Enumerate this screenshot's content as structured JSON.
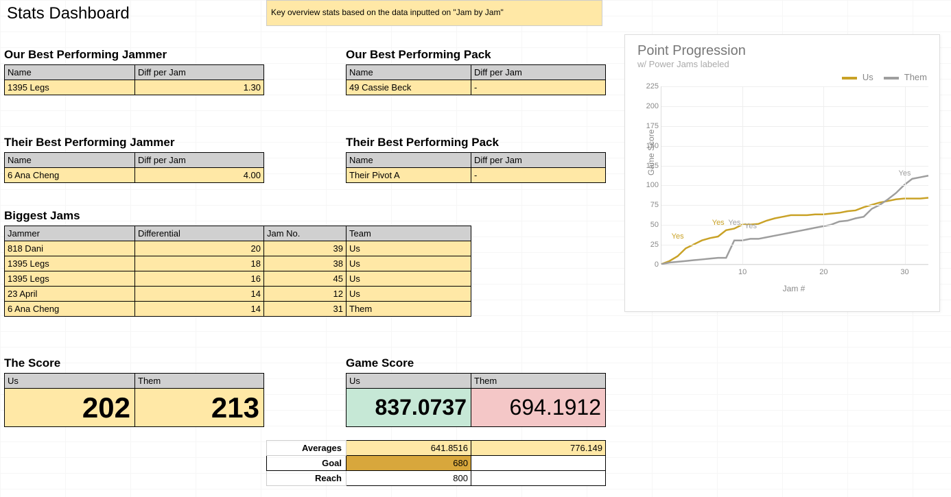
{
  "header": {
    "title": "Stats Dashboard",
    "banner": "Key overview stats based on the data inputted on \"Jam by Jam\""
  },
  "our_jammer": {
    "heading": "Our Best Performing Jammer",
    "col_name": "Name",
    "col_diff": "Diff per Jam",
    "name": "1395 Legs",
    "diff": "1.30"
  },
  "our_pack": {
    "heading": "Our Best Performing Pack",
    "col_name": "Name",
    "col_diff": "Diff per Jam",
    "name": "49 Cassie Beck",
    "diff": "-"
  },
  "their_jammer": {
    "heading": "Their Best Performing Jammer",
    "col_name": "Name",
    "col_diff": "Diff per Jam",
    "name": "6 Ana Cheng",
    "diff": "4.00"
  },
  "their_pack": {
    "heading": "Their Best Performing Pack",
    "col_name": "Name",
    "col_diff": "Diff per Jam",
    "name": "Their Pivot A",
    "diff": "-"
  },
  "biggest": {
    "heading": "Biggest Jams",
    "cols": {
      "jammer": "Jammer",
      "diff": "Differential",
      "jamno": "Jam No.",
      "team": "Team"
    },
    "rows": [
      {
        "jammer": "818 Dani",
        "diff": "20",
        "jamno": "39",
        "team": "Us"
      },
      {
        "jammer": "1395 Legs",
        "diff": "18",
        "jamno": "38",
        "team": "Us"
      },
      {
        "jammer": "1395 Legs",
        "diff": "16",
        "jamno": "45",
        "team": "Us"
      },
      {
        "jammer": "23 April",
        "diff": "14",
        "jamno": "12",
        "team": "Us"
      },
      {
        "jammer": "6 Ana Cheng",
        "diff": "14",
        "jamno": "31",
        "team": "Them"
      }
    ]
  },
  "score": {
    "heading": "The Score",
    "col_us": "Us",
    "col_them": "Them",
    "us": "202",
    "them": "213"
  },
  "gamescore": {
    "heading": "Game Score",
    "col_us": "Us",
    "col_them": "Them",
    "us": "837.0737",
    "them": "694.1912",
    "labels": {
      "avg": "Averages",
      "goal": "Goal",
      "reach": "Reach"
    },
    "avg_us": "641.8516",
    "avg_them": "776.149",
    "goal": "680",
    "reach": "800"
  },
  "chart_meta": {
    "title": "Point Progression",
    "subtitle": "w/ Power Jams labeled",
    "legend_us": "Us",
    "legend_them": "Them",
    "ylabel": "Game Score",
    "xlabel": "Jam #"
  },
  "chart_data": {
    "type": "line",
    "title": "Point Progression",
    "xlabel": "Jam #",
    "ylabel": "Game Score",
    "ylim": [
      0,
      225
    ],
    "xlim": [
      0,
      33
    ],
    "x": [
      0,
      1,
      2,
      3,
      4,
      5,
      6,
      7,
      8,
      9,
      10,
      11,
      12,
      13,
      14,
      15,
      16,
      17,
      18,
      19,
      20,
      21,
      22,
      23,
      24,
      25,
      26,
      27,
      28,
      29,
      30,
      31,
      32,
      33
    ],
    "series": [
      {
        "name": "Us",
        "color": "#c9a227",
        "values": [
          0,
          4,
          10,
          20,
          25,
          30,
          33,
          35,
          43,
          45,
          50,
          50,
          51,
          55,
          58,
          60,
          62,
          62,
          62,
          63,
          63,
          64,
          65,
          67,
          68,
          72,
          75,
          78,
          80,
          82,
          83,
          83,
          83,
          84
        ]
      },
      {
        "name": "Them",
        "color": "#9e9e9e",
        "values": [
          0,
          2,
          3,
          4,
          5,
          6,
          7,
          8,
          8,
          30,
          30,
          32,
          32,
          34,
          36,
          38,
          40,
          42,
          44,
          46,
          48,
          50,
          54,
          55,
          58,
          60,
          70,
          75,
          82,
          90,
          100,
          108,
          110,
          112
        ]
      }
    ],
    "annotations": [
      {
        "series": "Us",
        "text": "Yes",
        "x": 2,
        "y": 30
      },
      {
        "series": "Us",
        "text": "Yes",
        "x": 7,
        "y": 48
      },
      {
        "series": "Them",
        "text": "Yes",
        "x": 9,
        "y": 48
      },
      {
        "series": "Them",
        "text": "Yes",
        "x": 11,
        "y": 43
      },
      {
        "series": "Them",
        "text": "Yes",
        "x": 30,
        "y": 110
      }
    ],
    "yticks": [
      0,
      25,
      50,
      75,
      100,
      125,
      150,
      175,
      200,
      225
    ],
    "xticks": [
      10,
      20,
      30
    ]
  }
}
